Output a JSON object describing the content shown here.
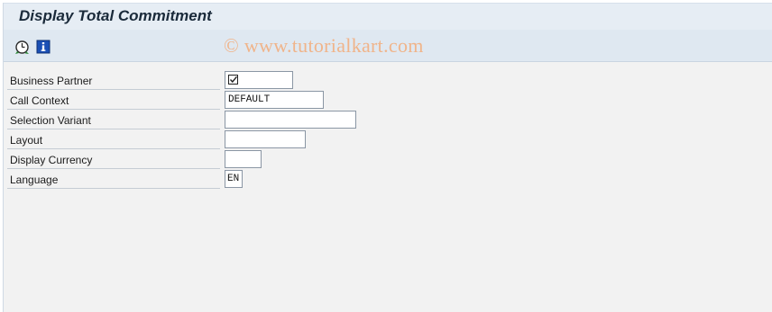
{
  "window": {
    "title": "Display Total Commitment"
  },
  "toolbar": {
    "watermark": "© www.tutorialkart.com",
    "buttons": [
      {
        "icon": "execute-clock-icon"
      },
      {
        "icon": "info-icon"
      }
    ]
  },
  "form": {
    "rows": [
      {
        "label": "Business Partner",
        "value": "",
        "required_icon": "required-checkbox-icon"
      },
      {
        "label": "Call Context",
        "value": "DEFAULT"
      },
      {
        "label": "Selection Variant",
        "value": ""
      },
      {
        "label": "Layout",
        "value": ""
      },
      {
        "label": "Display Currency",
        "value": ""
      },
      {
        "label": "Language",
        "value": "EN"
      }
    ]
  },
  "colors": {
    "title_bar": "#e6edf4",
    "toolbar": "#dfe8f1",
    "watermark": "#f0b48a",
    "background": "#f2f2f2"
  }
}
